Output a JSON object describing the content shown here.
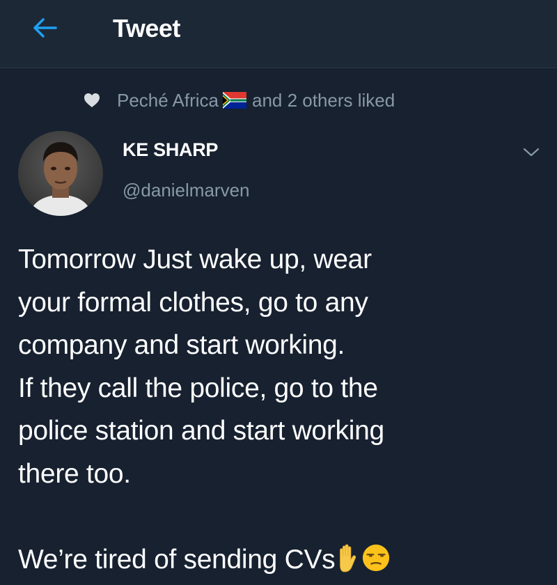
{
  "header": {
    "title": "Tweet"
  },
  "social_context": {
    "liker": "Peché Africa",
    "suffix": "and 2 others liked",
    "icon": "heart-icon",
    "flag_icon": "south-africa-flag-icon"
  },
  "author": {
    "display_name": "KE SHARP",
    "handle": "@danielmarven"
  },
  "tweet": {
    "lines": [
      "Tomorrow Just wake up, wear",
      "your formal clothes, go to any",
      "company and start working.",
      "If they call the police, go to the",
      "police station and start working",
      "there too."
    ],
    "closing": "We’re tired of sending CVs",
    "emojis": [
      "raised-hand-emoji",
      "unamused-face-emoji"
    ]
  },
  "colors": {
    "background": "#172130",
    "header_bg": "#1d2837",
    "accent": "#1da1f2",
    "secondary_text": "#8899a6"
  }
}
